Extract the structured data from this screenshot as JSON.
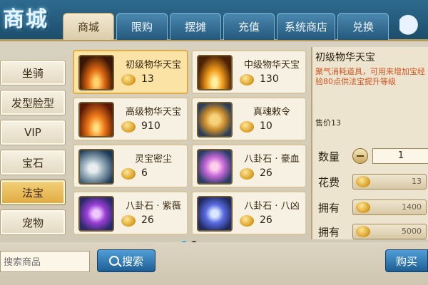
{
  "logo": {
    "text": "商城"
  },
  "tabs": [
    "商城",
    "限购",
    "摆摊",
    "充值",
    "系统商店",
    "兑换"
  ],
  "sidebar": {
    "items": [
      "坐骑",
      "发型脸型",
      "VIP",
      "宝石",
      "法宝",
      "宠物"
    ],
    "selected": "法宝"
  },
  "items": [
    {
      "name": "初级物华天宝",
      "price": "13",
      "icon": "fire-pillar-icon",
      "selected": true
    },
    {
      "name": "中级物华天宝",
      "price": "130",
      "icon": "fire-pillar-icon"
    },
    {
      "name": "高级物华天宝",
      "price": "910",
      "icon": "flame-icon"
    },
    {
      "name": "真魂敕令",
      "price": "10",
      "icon": "talisman-icon"
    },
    {
      "name": "灵宝密尘",
      "price": "6",
      "icon": "jade-pendant-icon"
    },
    {
      "name": "八卦石 · 豪血",
      "price": "26",
      "icon": "bagua-stone-pink-icon"
    },
    {
      "name": "八卦石 · 紫薇",
      "price": "26",
      "icon": "bagua-stone-purple-icon"
    },
    {
      "name": "八卦石 · 八凶",
      "price": "26",
      "icon": "bagua-stone-blue-icon"
    }
  ],
  "detail": {
    "title": "初级物华天宝",
    "description": "聚气消耗道具，可用来增加宝经验80点供法宝提升等级",
    "price_text": "售价13",
    "quantity_label": "数量",
    "quantity_value": "1",
    "cost_label": "花费",
    "cost_value": "13",
    "own_label_1": "拥有",
    "own_value_1": "1400",
    "own_label_2": "拥有",
    "own_value_2": "5000"
  },
  "search": {
    "placeholder": "搜索商品",
    "button": "搜索"
  },
  "buy_button": "购买",
  "pagination": {
    "pages": 2,
    "current": 1
  }
}
